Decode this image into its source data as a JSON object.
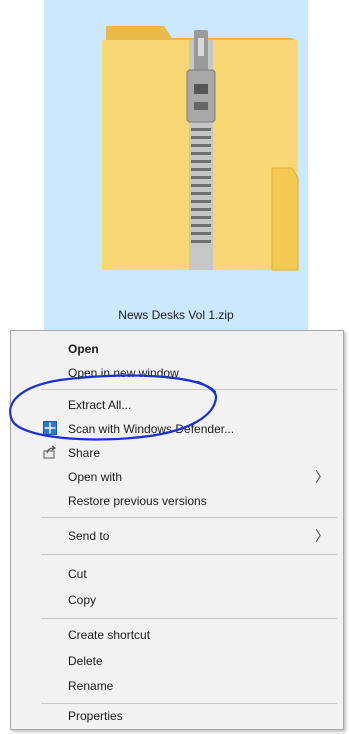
{
  "file": {
    "name": "News Desks Vol 1.zip",
    "icon": "zip-folder-icon"
  },
  "menu": {
    "items": [
      {
        "label": "Open",
        "bold": true
      },
      {
        "label": "Open in new window"
      },
      {
        "label": "Extract All..."
      },
      {
        "label": "Scan with Windows Defender...",
        "icon": "windows-defender-icon"
      },
      {
        "label": "Share",
        "icon": "share-icon"
      },
      {
        "label": "Open with",
        "submenu": true
      },
      {
        "label": "Restore previous versions"
      },
      {
        "label": "Send to",
        "submenu": true
      },
      {
        "label": "Cut"
      },
      {
        "label": "Copy"
      },
      {
        "label": "Create shortcut"
      },
      {
        "label": "Delete"
      },
      {
        "label": "Rename"
      },
      {
        "label": "Properties"
      }
    ],
    "submenu_glyph": "〉"
  },
  "colors": {
    "selection": "#cce8ff",
    "annotation": "#1a2fd8",
    "folder": "#f8d775"
  }
}
